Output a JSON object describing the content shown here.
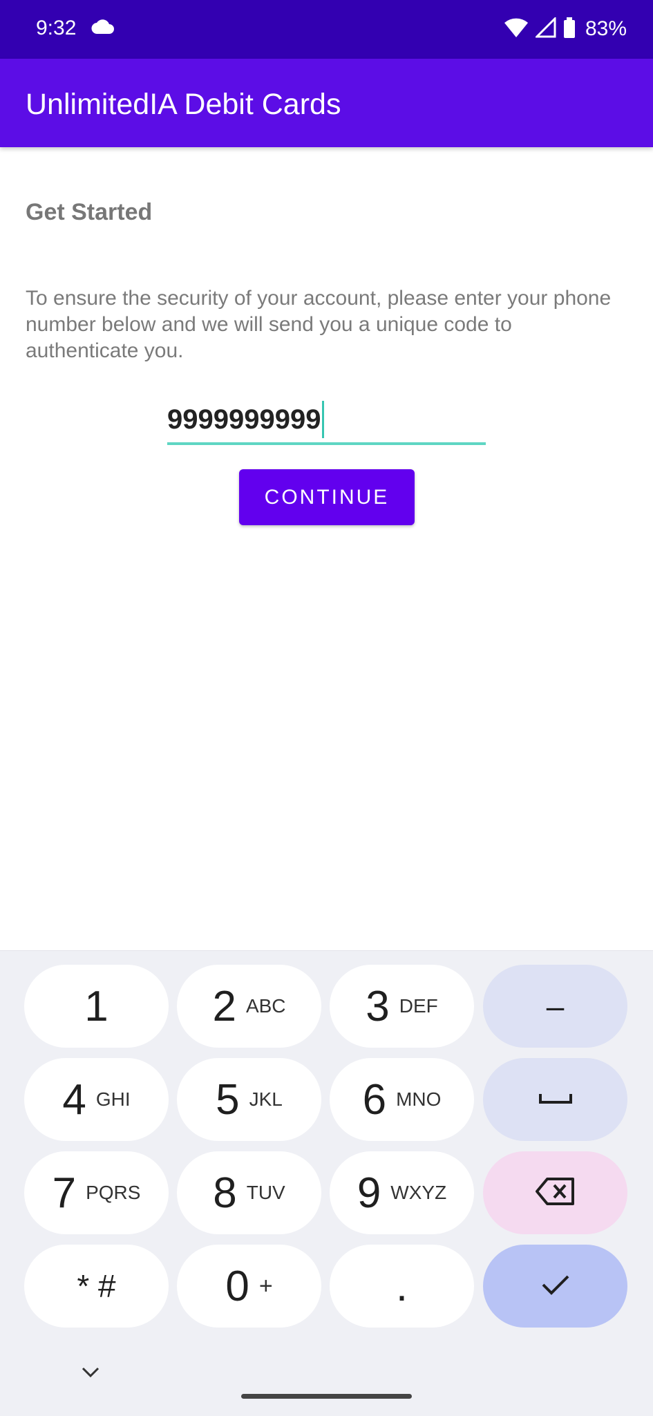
{
  "status_bar": {
    "time": "9:32",
    "battery_percent": "83%",
    "icons": [
      "cloud-icon",
      "wifi-icon",
      "cellular-signal-icon",
      "battery-icon"
    ]
  },
  "app_bar": {
    "title": "UnlimitedIA Debit Cards"
  },
  "main": {
    "heading": "Get Started",
    "instructions": "To ensure the security of your account, please enter your phone number below and we will send you a unique code to authenticate you.",
    "phone_input": {
      "value": "9999999999"
    },
    "continue_label": "CONTINUE"
  },
  "keyboard": {
    "keys": [
      {
        "digit": "1",
        "letters": ""
      },
      {
        "digit": "2",
        "letters": "ABC"
      },
      {
        "digit": "3",
        "letters": "DEF"
      },
      {
        "digit": "4",
        "letters": "GHI"
      },
      {
        "digit": "5",
        "letters": "JKL"
      },
      {
        "digit": "6",
        "letters": "MNO"
      },
      {
        "digit": "7",
        "letters": "PQRS"
      },
      {
        "digit": "8",
        "letters": "TUV"
      },
      {
        "digit": "9",
        "letters": "WXYZ"
      },
      {
        "digit": "* #",
        "letters": ""
      },
      {
        "digit": "0",
        "letters": "+"
      },
      {
        "digit": ".",
        "letters": ""
      }
    ],
    "minus": "–"
  },
  "colors": {
    "status_bar": "#3300b1",
    "app_bar": "#5c0de6",
    "accent_button": "#6200ee",
    "input_underline": "#5fd6c3"
  }
}
